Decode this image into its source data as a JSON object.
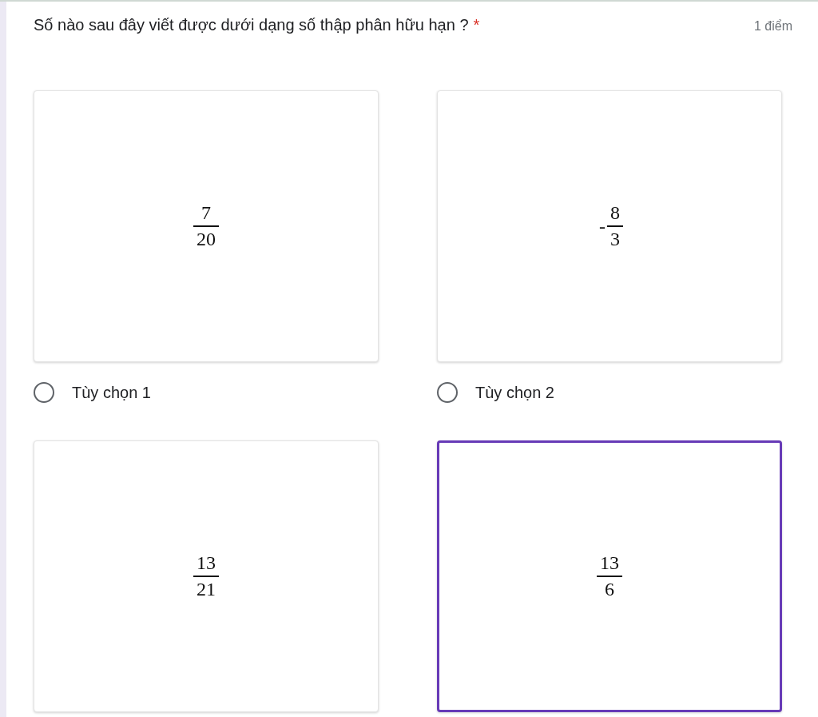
{
  "question": {
    "title": "Số nào sau đây viết được dưới dạng số thập phân hữu hạn ?",
    "required_mark": "*",
    "points": "1 điểm"
  },
  "options": [
    {
      "numerator": "7",
      "denominator": "20",
      "label": "Tùy chọn 1",
      "selected": false
    },
    {
      "sign": "-",
      "numerator": "8",
      "denominator": "3",
      "label": "Tùy chọn 2",
      "selected": false
    },
    {
      "numerator": "13",
      "denominator": "21",
      "selected": false
    },
    {
      "numerator": "13",
      "denominator": "6",
      "selected": true
    }
  ]
}
